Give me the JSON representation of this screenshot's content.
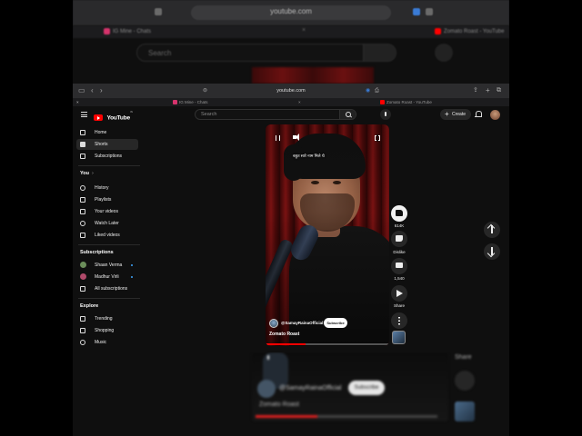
{
  "background": {
    "address_url": "youtube.com",
    "tabs": [
      {
        "label": "IG Mine - Chats",
        "color": "#d6336c"
      },
      {
        "label": "Zomato Roast - YouTube",
        "color": "#ff0000"
      }
    ],
    "search_placeholder": "Search",
    "channel": "@SamayRainaOfficial",
    "subscribe": "Subscribe",
    "video_title": "Zomato Roast",
    "share_label": "Share"
  },
  "browser": {
    "url": "youtube.com",
    "tabs": [
      {
        "label": "IG Mine - Chats",
        "color": "#d6336c"
      },
      {
        "label": "Zomato Roast - YouTube",
        "color": "#ff0000"
      }
    ]
  },
  "header": {
    "logo_text": "YouTube",
    "logo_suffix": "IN",
    "search_placeholder": "Search",
    "create_label": "Create"
  },
  "sidebar": {
    "main": [
      {
        "label": "Home",
        "icon": "home-icon"
      },
      {
        "label": "Shorts",
        "icon": "shorts-icon",
        "active": true
      },
      {
        "label": "Subscriptions",
        "icon": "subscriptions-icon"
      }
    ],
    "you_heading": "You",
    "you": [
      {
        "label": "History",
        "icon": "history-icon"
      },
      {
        "label": "Playlists",
        "icon": "playlists-icon"
      },
      {
        "label": "Your videos",
        "icon": "your-videos-icon"
      },
      {
        "label": "Watch Later",
        "icon": "watch-later-icon"
      },
      {
        "label": "Liked videos",
        "icon": "liked-videos-icon"
      }
    ],
    "subs_heading": "Subscriptions",
    "subs": [
      {
        "label": "Shaan Verma",
        "color": "#6b8e5a"
      },
      {
        "label": "Madhur Virli",
        "color": "#b04a6a"
      },
      {
        "label": "All subscriptions",
        "icon": "list-icon"
      }
    ],
    "explore_heading": "Explore",
    "explore": [
      {
        "label": "Trending",
        "icon": "trending-icon"
      },
      {
        "label": "Shopping",
        "icon": "shopping-icon"
      },
      {
        "label": "Music",
        "icon": "music-icon"
      }
    ]
  },
  "short": {
    "caption": "बहुत सारे नाम मिले थे",
    "channel": "@SamayRainaOfficial",
    "subscribe_label": "Subscribe",
    "title": "Zomato Roast",
    "progress": 0.32
  },
  "actions": {
    "likes": "614K",
    "dislike_label": "Dislike",
    "comments": "1,540",
    "share_label": "Share"
  }
}
